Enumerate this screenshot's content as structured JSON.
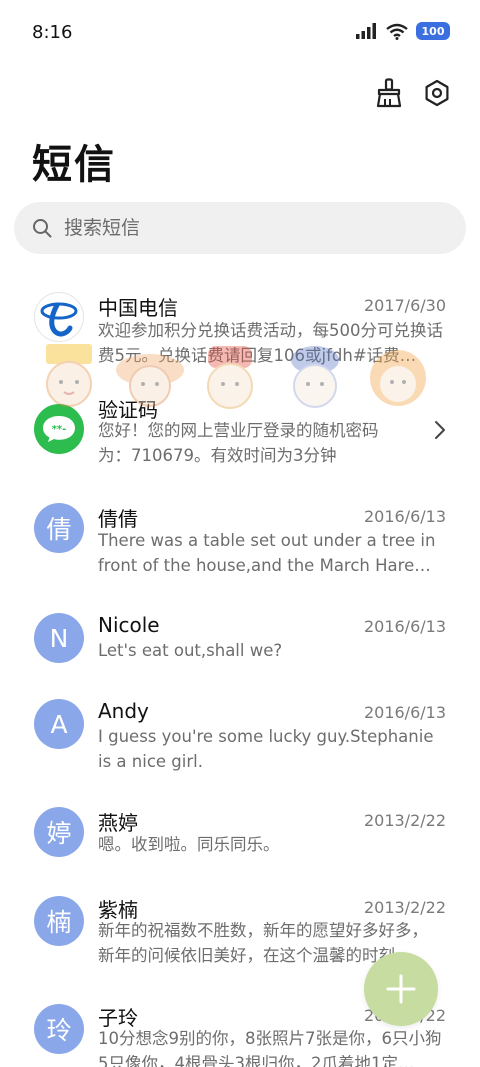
{
  "status_bar": {
    "time": "8:16",
    "battery": "100"
  },
  "header": {
    "title": "短信",
    "icons": [
      "broom-icon",
      "settings-icon"
    ]
  },
  "search": {
    "placeholder": "搜索短信"
  },
  "messages": [
    {
      "name": "中国电信",
      "date": "2017/6/30",
      "preview": "欢迎参加积分兑换话费活动，每500分可兑换话费5元。兑换话费请回复106或jfdh#话费…",
      "avatar": "telecom-logo"
    },
    {
      "name": "验证码",
      "date": "",
      "preview": "您好！您的网上营业厅登录的随机密码为：710679。有效时间为3分钟",
      "avatar": "verify-code-icon"
    },
    {
      "name": "倩倩",
      "date": "2016/6/13",
      "preview": "There was a table set out under a tree in front of the house,and the March Hare an…",
      "avatar": "倩"
    },
    {
      "name": "Nicole",
      "date": "2016/6/13",
      "preview": "Let's eat out,shall we?",
      "avatar": "N"
    },
    {
      "name": "Andy",
      "date": "2016/6/13",
      "preview": "I guess you're some lucky guy.Stephanie is a nice girl.",
      "avatar": "A"
    },
    {
      "name": "燕婷",
      "date": "2013/2/22",
      "preview": "嗯。收到啦。同乐同乐。",
      "avatar": "婷"
    },
    {
      "name": "紫楠",
      "date": "2013/2/22",
      "preview": "新年的祝福数不胜数，新年的愿望好多好多，新年的问候依旧美好，在这个温馨的时刻…",
      "avatar": "楠"
    },
    {
      "name": "子玲",
      "date": "2013/2/22",
      "preview": "10分想念9别的你，8张照片7张是你，6只小狗5只像你，4根骨头3根归你，2爪着地1定…",
      "avatar": "玲"
    }
  ],
  "colors": {
    "avatar_letter_bg": "#8aa7ea",
    "verify_green": "#2dbd4e",
    "telecom_blue": "#1565c8",
    "fab_bg": "#c7dca0",
    "search_bg": "#f0f0f0"
  }
}
